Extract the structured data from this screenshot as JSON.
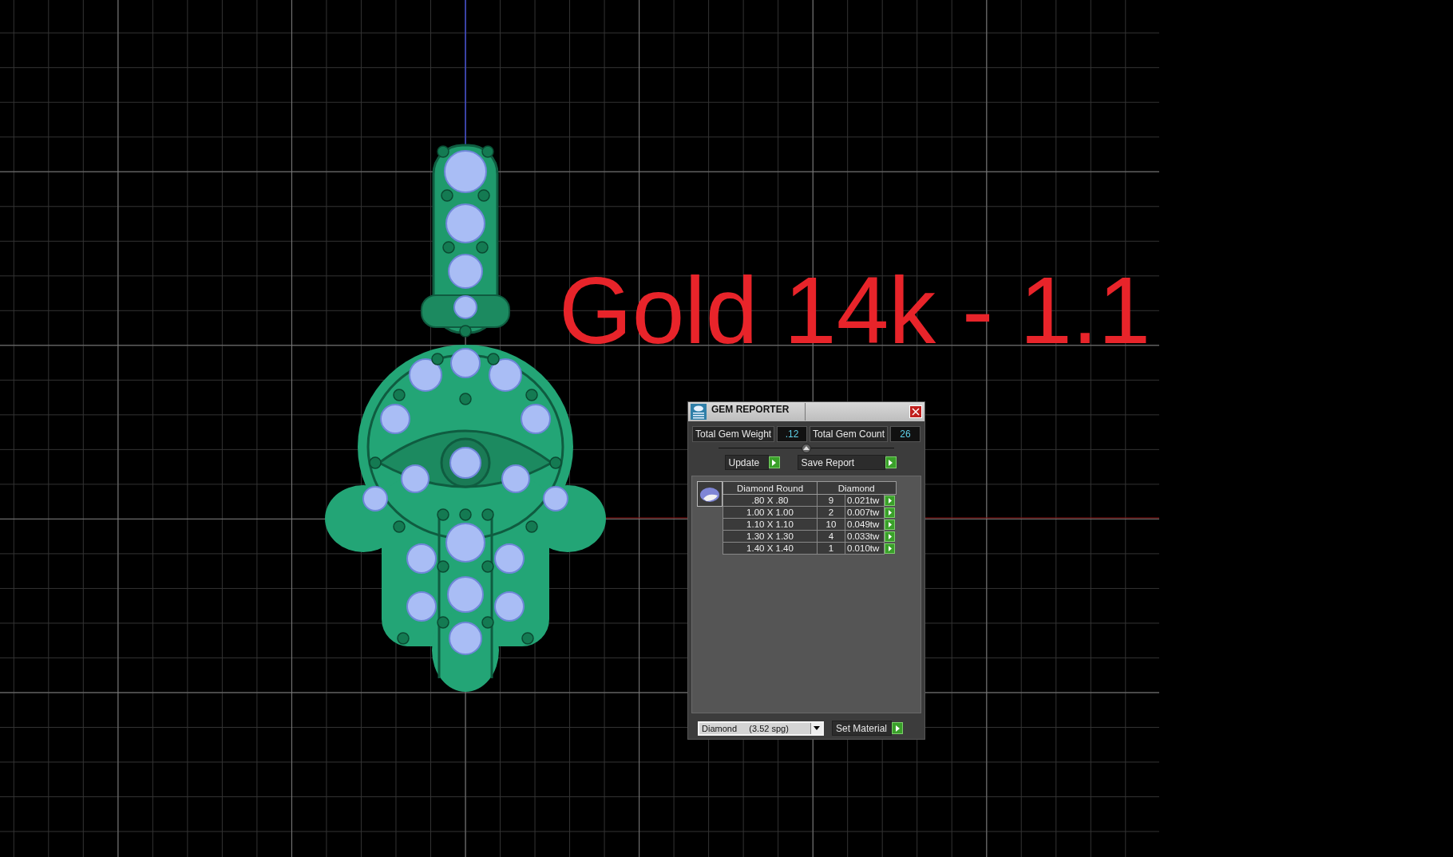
{
  "viewport": {
    "label": "Gold 14k - 1.1"
  },
  "gem_reporter": {
    "title": "GEM REPORTER",
    "total_gem_weight": {
      "label": "Total Gem Weight",
      "value": ".12"
    },
    "total_gem_count": {
      "label": "Total Gem Count",
      "value": "26"
    },
    "buttons": [
      {
        "label": "Update"
      },
      {
        "label": "Save Report"
      }
    ],
    "table": {
      "columns": [
        "Diamond Round",
        "Diamond"
      ],
      "rows": [
        {
          "size": ".80 X .80",
          "count": "9",
          "weight": "0.021tw"
        },
        {
          "size": "1.00 X 1.00",
          "count": "2",
          "weight": "0.007tw"
        },
        {
          "size": "1.10 X 1.10",
          "count": "10",
          "weight": "0.049tw"
        },
        {
          "size": "1.30 X 1.30",
          "count": "4",
          "weight": "0.033tw"
        },
        {
          "size": "1.40 X 1.40",
          "count": "1",
          "weight": "0.010tw"
        }
      ]
    },
    "material": {
      "value": "Diamond     (3.52 spg)"
    },
    "set_material": {
      "label": "Set Material"
    }
  }
}
